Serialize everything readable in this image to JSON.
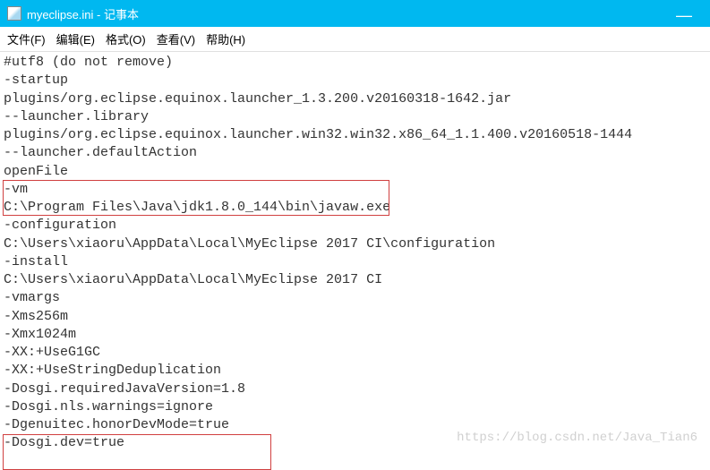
{
  "window": {
    "title": "myeclipse.ini - 记事本",
    "minimize": "—"
  },
  "menu": {
    "file": "文件(F)",
    "edit": "编辑(E)",
    "format": "格式(O)",
    "view": "查看(V)",
    "help": "帮助(H)"
  },
  "lines": [
    "#utf8 (do not remove)",
    "-startup",
    "plugins/org.eclipse.equinox.launcher_1.3.200.v20160318-1642.jar",
    "--launcher.library",
    "plugins/org.eclipse.equinox.launcher.win32.win32.x86_64_1.1.400.v20160518-1444",
    "--launcher.defaultAction",
    "openFile",
    "-vm",
    "C:\\Program Files\\Java\\jdk1.8.0_144\\bin\\javaw.exe",
    "-configuration",
    "C:\\Users\\xiaoru\\AppData\\Local\\MyEclipse 2017 CI\\configuration",
    "-install",
    "C:\\Users\\xiaoru\\AppData\\Local\\MyEclipse 2017 CI",
    "-vmargs",
    "-Xms256m",
    "-Xmx1024m",
    "-XX:+UseG1GC",
    "-XX:+UseStringDeduplication",
    "-Dosgi.requiredJavaVersion=1.8",
    "-Dosgi.nls.warnings=ignore",
    "-Dgenuitec.honorDevMode=true",
    "-Dosgi.dev=true"
  ],
  "watermark": "https://blog.csdn.net/Java_Tian6"
}
